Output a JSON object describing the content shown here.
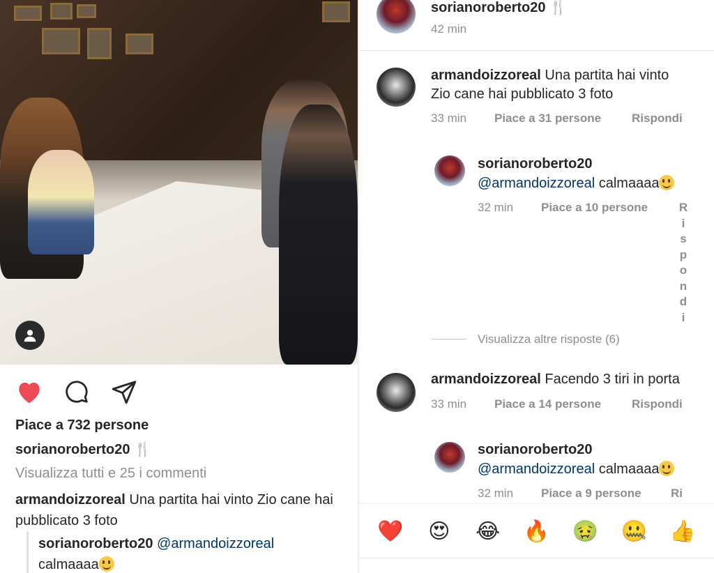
{
  "post": {
    "likes_text": "Piace a 732 persone",
    "caption_user": "sorianoroberto20 🍴",
    "view_all_comments": "Visualizza tutti e 25 i commenti",
    "comments": [
      {
        "user": "armandoizzoreal",
        "text": "Una partita hai vinto Zio cane hai pubblicato 3 foto"
      },
      {
        "user": "sorianoroberto20",
        "mention": "@armandoizzoreal",
        "text": "calmaaaa"
      }
    ]
  },
  "thread": {
    "header": {
      "user": "sorianoroberto20 🍴",
      "time": "42 min"
    },
    "items": [
      {
        "user": "armandoizzoreal",
        "text_line1": "Una partita hai vinto",
        "text_line2": "Zio cane hai pubblicato 3 foto",
        "time": "33 min",
        "likes": "Piace a 31 persone",
        "reply": "Rispondi"
      },
      {
        "user": "sorianoroberto20",
        "mention": "@armandoizzoreal",
        "text": "calmaaaa",
        "time": "32 min",
        "likes": "Piace a 10 persone",
        "reply": "Rispondi"
      },
      {
        "user": "armandoizzoreal",
        "text": "Facendo 3 tiri in porta",
        "time": "33 min",
        "likes": "Piace a 14 persone",
        "reply": "Rispondi"
      },
      {
        "user": "sorianoroberto20",
        "mention": "@armandoizzoreal",
        "text": "calmaaaa",
        "time": "32 min",
        "likes": "Piace a 9 persone",
        "reply": "Ri"
      }
    ],
    "view_more_replies": "Visualizza altre risposte (6)"
  },
  "emoji_bar": [
    "❤️",
    "😍",
    "😂",
    "🔥",
    "🤢",
    "🤐",
    "👍"
  ],
  "colors": {
    "like": "#ed4956",
    "text": "#262626",
    "muted": "#8e8e8e",
    "mention": "#003569"
  },
  "icons": {
    "like": "heart-icon",
    "comment": "comment-bubble-icon",
    "share": "paper-plane-icon",
    "user": "user-tag-icon"
  }
}
